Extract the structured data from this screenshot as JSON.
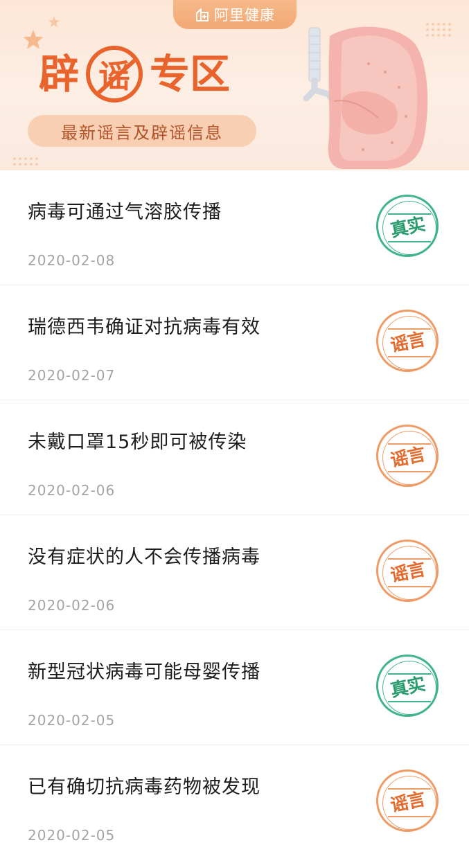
{
  "banner": {
    "brand": "阿里健康",
    "title_left": "辟",
    "title_circle": "谣",
    "title_right": "专区",
    "subtitle": "最新谣言及辟谣信息"
  },
  "colors": {
    "accent_orange": "#e8642c",
    "true_green": "#3fb48a",
    "rumor_orange": "#ef9b66",
    "date_gray": "#a3a3a3"
  },
  "items": [
    {
      "title": "病毒可通过气溶胶传播",
      "date": "2020-02-08",
      "verdict": "真实",
      "type": "true"
    },
    {
      "title": "瑞德西韦确证对抗病毒有效",
      "date": "2020-02-07",
      "verdict": "谣言",
      "type": "rumor"
    },
    {
      "title": "未戴口罩15秒即可被传染",
      "date": "2020-02-06",
      "verdict": "谣言",
      "type": "rumor"
    },
    {
      "title": "没有症状的人不会传播病毒",
      "date": "2020-02-06",
      "verdict": "谣言",
      "type": "rumor"
    },
    {
      "title": "新型冠状病毒可能母婴传播",
      "date": "2020-02-05",
      "verdict": "真实",
      "type": "true"
    },
    {
      "title": "已有确切抗病毒药物被发现",
      "date": "2020-02-05",
      "verdict": "谣言",
      "type": "rumor"
    }
  ]
}
